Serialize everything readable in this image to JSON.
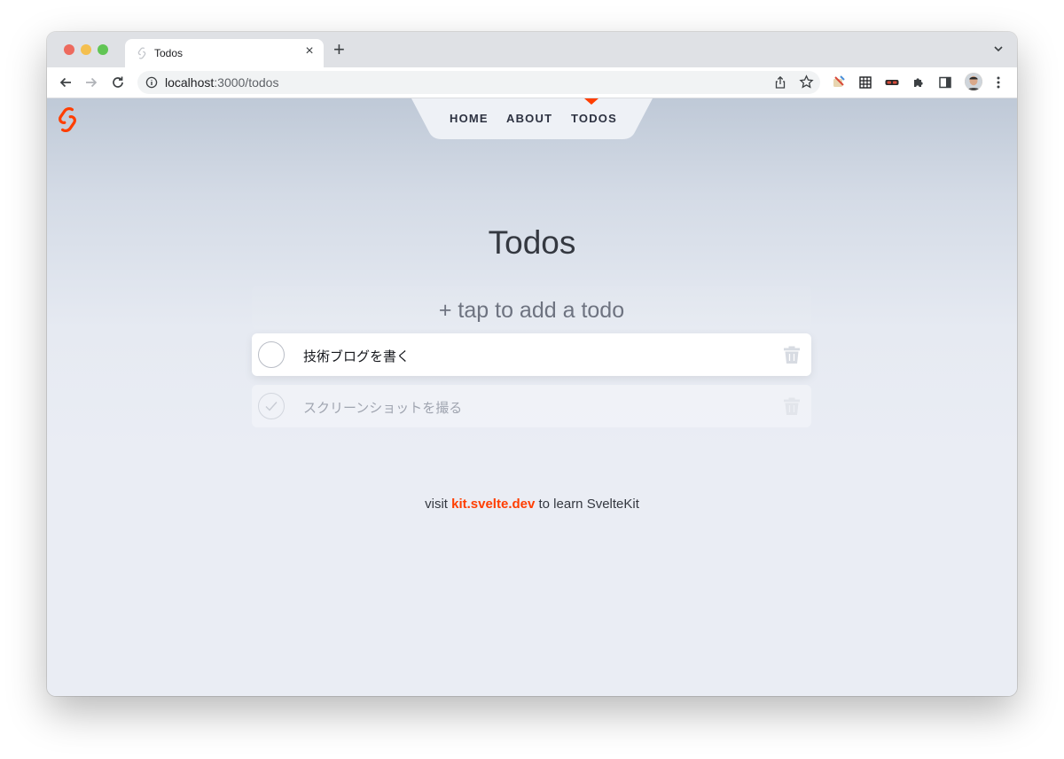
{
  "browser": {
    "tab_title": "Todos",
    "tab_close": "×",
    "new_tab": "+",
    "url_host": "localhost",
    "url_path": ":3000/todos"
  },
  "nav": {
    "items": [
      {
        "label": "HOME"
      },
      {
        "label": "ABOUT"
      },
      {
        "label": "TODOS",
        "active": true
      }
    ]
  },
  "main": {
    "title": "Todos",
    "new_todo_placeholder": "+ tap to add a todo",
    "todos": [
      {
        "text": "技術ブログを書く",
        "done": false
      },
      {
        "text": "スクリーンショットを撮る",
        "done": true
      }
    ]
  },
  "footer": {
    "prefix": "visit ",
    "link_text": "kit.svelte.dev",
    "suffix": " to learn SvelteKit"
  },
  "colors": {
    "accent": "#ff3e00",
    "nav_bg": "#eef1f6",
    "page_bg": "#eaedf4"
  },
  "icons": {
    "back": "back-arrow-icon",
    "forward": "forward-arrow-icon",
    "reload": "reload-icon",
    "info": "info-icon",
    "share": "share-icon",
    "bookmark": "star-icon",
    "extension": "puzzle-icon",
    "delete": "trash-icon",
    "check": "check-icon"
  }
}
